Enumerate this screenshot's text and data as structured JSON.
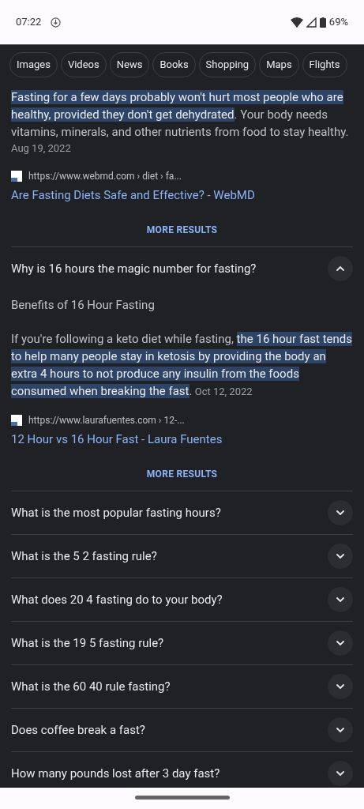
{
  "status_bar": {
    "time": "07:22",
    "battery": "69%"
  },
  "chips": [
    {
      "label": "Images"
    },
    {
      "label": "Videos"
    },
    {
      "label": "News"
    },
    {
      "label": "Books"
    },
    {
      "label": "Shopping"
    },
    {
      "label": "Maps"
    },
    {
      "label": "Flights"
    }
  ],
  "top_answer": {
    "snippet": [
      {
        "text": "Fasting for a few days probably won't hurt most people who are healthy, provided they don't get dehydrated",
        "highlighted": true
      },
      {
        "text": ". Your body needs vitamins, minerals, and other nutrients from food to stay healthy.",
        "highlighted": false
      }
    ],
    "date": "Aug 19, 2022",
    "url": "https://www.webmd.com › diet › fa...",
    "link": "Are Fasting Diets Safe and Effective? - WebMD",
    "more": "MORE RESULTS"
  },
  "questions": [
    {
      "question": "Why is 16 hours the magic number for fasting?",
      "expanded": true,
      "heading": "Benefits of 16 Hour Fasting",
      "snippet": [
        {
          "text": "If you're following a keto diet while fasting, ",
          "highlighted": false
        },
        {
          "text": "the 16 hour fast tends to help many people stay in ketosis by providing the body an extra 4 hours to not produce any insulin from the foods consumed when breaking the fast",
          "highlighted": true
        },
        {
          "text": ".",
          "highlighted": false
        }
      ],
      "date": "Oct 12, 2022",
      "url": "https://www.laurafuentes.com › 12-...",
      "link": "12 Hour vs 16 Hour Fast - Laura Fuentes",
      "more": "MORE RESULTS"
    },
    {
      "question": "What is the most popular fasting hours?",
      "expanded": false
    },
    {
      "question": "What is the 5 2 fasting rule?",
      "expanded": false
    },
    {
      "question": "What does 20 4 fasting do to your body?",
      "expanded": false
    },
    {
      "question": "What is the 19 5 fasting rule?",
      "expanded": false
    },
    {
      "question": "What is the 60 40 rule fasting?",
      "expanded": false
    },
    {
      "question": "Does coffee break a fast?",
      "expanded": false
    },
    {
      "question": "How many pounds lost after 3 day fast?",
      "expanded": false
    }
  ]
}
